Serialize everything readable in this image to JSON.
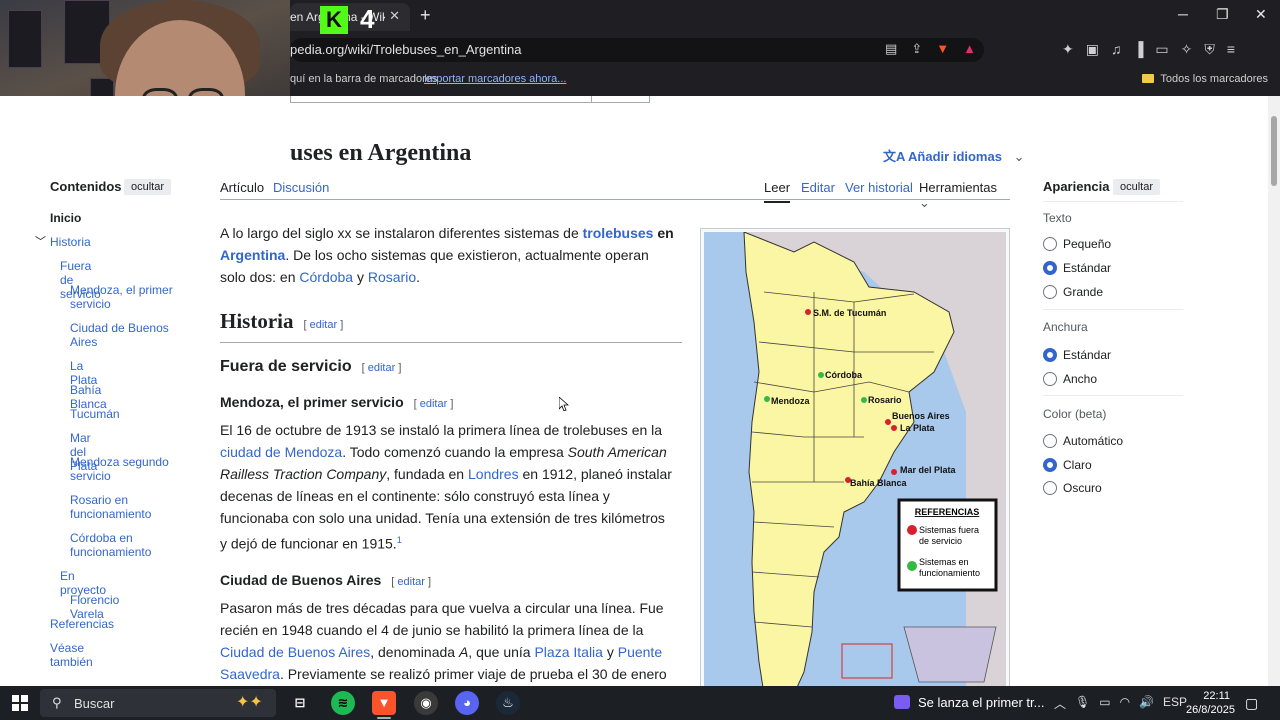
{
  "browser": {
    "tab_title": "en Argentina - Wikipedia",
    "tab_close": "✕",
    "new_tab": "+",
    "kick_logo": "K",
    "kick_number": "4",
    "window_minimize": "─",
    "window_maximize": "❐",
    "window_close": "✕",
    "url": "pedia.org/wiki/Trolebuses_en_Argentina",
    "bookmarks_text": "quí en la barra de marcadores",
    "bookmarks_import": "Importar marcadores ahora...",
    "bookmarks_all": "Todos los marcadores"
  },
  "article": {
    "title": "uses en Argentina",
    "add_languages": "Añadir idiomas",
    "tabs": {
      "article": "Artículo",
      "discussion": "Discusión",
      "read": "Leer",
      "edit": "Editar",
      "history": "Ver historial",
      "tools": "Herramientas"
    },
    "intro": {
      "t1": "A lo largo del siglo xx se instalaron diferentes sistemas de ",
      "l1": "trolebuses",
      "t2": " en ",
      "l2": "Argentina",
      "t3": ". De los ocho sistemas que existieron, actualmente operan solo dos: en ",
      "l3": "Córdoba",
      "t4": " y ",
      "l4": "Rosario",
      "t5": "."
    },
    "h_historia": "Historia",
    "h_fuera": "Fuera de servicio",
    "h_mendoza": "Mendoza, el primer servicio",
    "h_buenos_aires": "Ciudad de Buenos Aires",
    "edit_label": "editar",
    "bracket_open": "[",
    "bracket_close": "]",
    "mendoza": {
      "t1": "El 16 de octubre de 1913 se instaló la primera línea de trolebuses en la ",
      "l1": "ciudad de Mendoza",
      "t2": ". Todo comenzó cuando la empresa ",
      "i1": "South American Railless Traction Company",
      "t3": ", fundada en ",
      "l2": "Londres",
      "t4": " en 1912, planeó instalar decenas de líneas en el continente: sólo construyó esta línea y funcionaba con solo una unidad. Tenía una extensión de tres kilómetros y dejó de funcionar en 1915.",
      "ref": "1"
    },
    "buenos_aires": {
      "t1": "Pasaron más de tres décadas para que vuelva a circular una línea. Fue recién en 1948 cuando el 4 de junio se habilitó la primera línea de la ",
      "l1": "Ciudad de Buenos Aires",
      "t2": ", denominada ",
      "i1": "A",
      "t3": ", que unía ",
      "l2": "Plaza Italia",
      "t4": " y ",
      "l3": "Puente Saavedra",
      "t5": ". Previamente se realizó primer viaje de prueba el 30 de enero de ese año"
    }
  },
  "toc": {
    "title": "Contenidos",
    "hide": "ocultar",
    "items": {
      "inicio": "Inicio",
      "historia": "Historia",
      "fuera": "Fuera de servicio",
      "mendoza": "Mendoza, el primer servicio",
      "cba": "Ciudad de Buenos Aires",
      "laplata": "La Plata",
      "bahia": "Bahía Blanca",
      "tucuman": "Tucumán",
      "mardelplata": "Mar del Plata",
      "mendoza2": "Mendoza segundo servicio",
      "rosario": "Rosario en funcionamiento",
      "cordoba": "Córdoba en funcionamiento",
      "proyecto": "En proyecto",
      "florencio": "Florencio Varela",
      "referencias": "Referencias",
      "vease": "Véase también"
    }
  },
  "map": {
    "cities": {
      "tucuman": "S.M. de Tucumán",
      "cordoba": "Córdoba",
      "mendoza": "Mendoza",
      "rosario": "Rosario",
      "buenos_aires": "Buenos Aires",
      "la_plata": "La Plata",
      "mar_del_plata": "Mar del Plata",
      "bahia_blanca": "Bahía Blanca"
    },
    "legend_title": "REFERENCIAS",
    "legend_out_1": "Sistemas fuera",
    "legend_out_2": "de servicio",
    "legend_in_1": "Sistemas en",
    "legend_in_2": "funcionamiento",
    "colors": {
      "land": "#fbf6a3",
      "neighbor": "#d9d2d6",
      "sea": "#a8c8ec",
      "out_of_service": "#d9202f",
      "operating": "#35b844"
    }
  },
  "appearance": {
    "title": "Apariencia",
    "hide": "ocultar",
    "text_label": "Texto",
    "small": "Pequeño",
    "standard": "Estándar",
    "large": "Grande",
    "width_label": "Anchura",
    "width_standard": "Estándar",
    "width_wide": "Ancho",
    "color_label": "Color (beta)",
    "auto": "Automático",
    "light": "Claro",
    "dark": "Oscuro"
  },
  "taskbar": {
    "search": "Buscar",
    "notification": "Se lanza el primer tr...",
    "language": "ESP",
    "time": "22:11",
    "date": "26/8/2025"
  }
}
